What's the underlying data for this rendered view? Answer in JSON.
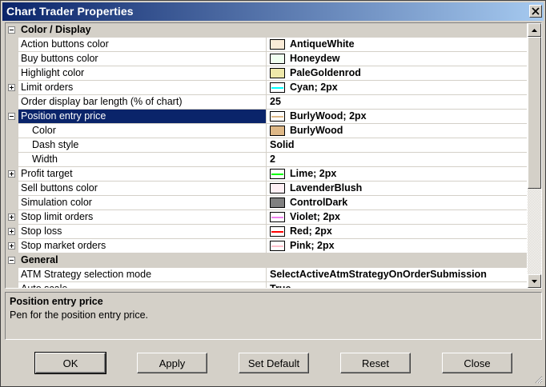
{
  "window": {
    "title": "Chart Trader Properties"
  },
  "grid": {
    "rows": [
      {
        "type": "category",
        "expander": "minus",
        "name": "Color / Display"
      },
      {
        "type": "prop",
        "name": "Action buttons color",
        "swatch": "#faebd7",
        "value": "AntiqueWhite"
      },
      {
        "type": "prop",
        "name": "Buy buttons color",
        "swatch": "#f0fff0",
        "value": "Honeydew"
      },
      {
        "type": "prop",
        "name": "Highlight color",
        "swatch": "#eee8aa",
        "value": "PaleGoldenrod"
      },
      {
        "type": "prop",
        "expander": "plus",
        "name": "Limit orders",
        "pen": "#00ffff",
        "value": "Cyan; 2px"
      },
      {
        "type": "prop",
        "name": "Order display bar length (% of chart)",
        "value": "25"
      },
      {
        "type": "prop",
        "expander": "minus",
        "selected": true,
        "name": "Position entry price",
        "pen": "#deb887",
        "value": "BurlyWood; 2px"
      },
      {
        "type": "sub",
        "name": "Color",
        "swatch": "#deb887",
        "value": "BurlyWood"
      },
      {
        "type": "sub",
        "name": "Dash style",
        "value": "Solid"
      },
      {
        "type": "sub",
        "name": "Width",
        "value": "2"
      },
      {
        "type": "prop",
        "expander": "plus",
        "name": "Profit target",
        "pen": "#00ff00",
        "value": "Lime; 2px"
      },
      {
        "type": "prop",
        "name": "Sell buttons color",
        "swatch": "#fff0f5",
        "value": "LavenderBlush"
      },
      {
        "type": "prop",
        "name": "Simulation color",
        "swatch": "#808080",
        "value": "ControlDark"
      },
      {
        "type": "prop",
        "expander": "plus",
        "name": "Stop limit orders",
        "pen": "#ee82ee",
        "value": "Violet; 2px"
      },
      {
        "type": "prop",
        "expander": "plus",
        "name": "Stop loss",
        "pen": "#ff0000",
        "value": "Red; 2px"
      },
      {
        "type": "prop",
        "expander": "plus",
        "name": "Stop market orders",
        "pen": "#ffc0cb",
        "value": "Pink; 2px"
      },
      {
        "type": "category",
        "expander": "minus",
        "name": "General"
      },
      {
        "type": "prop",
        "name": "ATM Strategy selection mode",
        "value": "SelectActiveAtmStrategyOnOrderSubmission"
      },
      {
        "type": "prop",
        "name": "Auto scale",
        "value": "True"
      }
    ]
  },
  "description": {
    "title": "Position entry price",
    "text": "Pen for the position entry price."
  },
  "buttons": {
    "ok": "OK",
    "apply": "Apply",
    "set_default": "Set Default",
    "reset": "Reset",
    "close": "Close"
  }
}
